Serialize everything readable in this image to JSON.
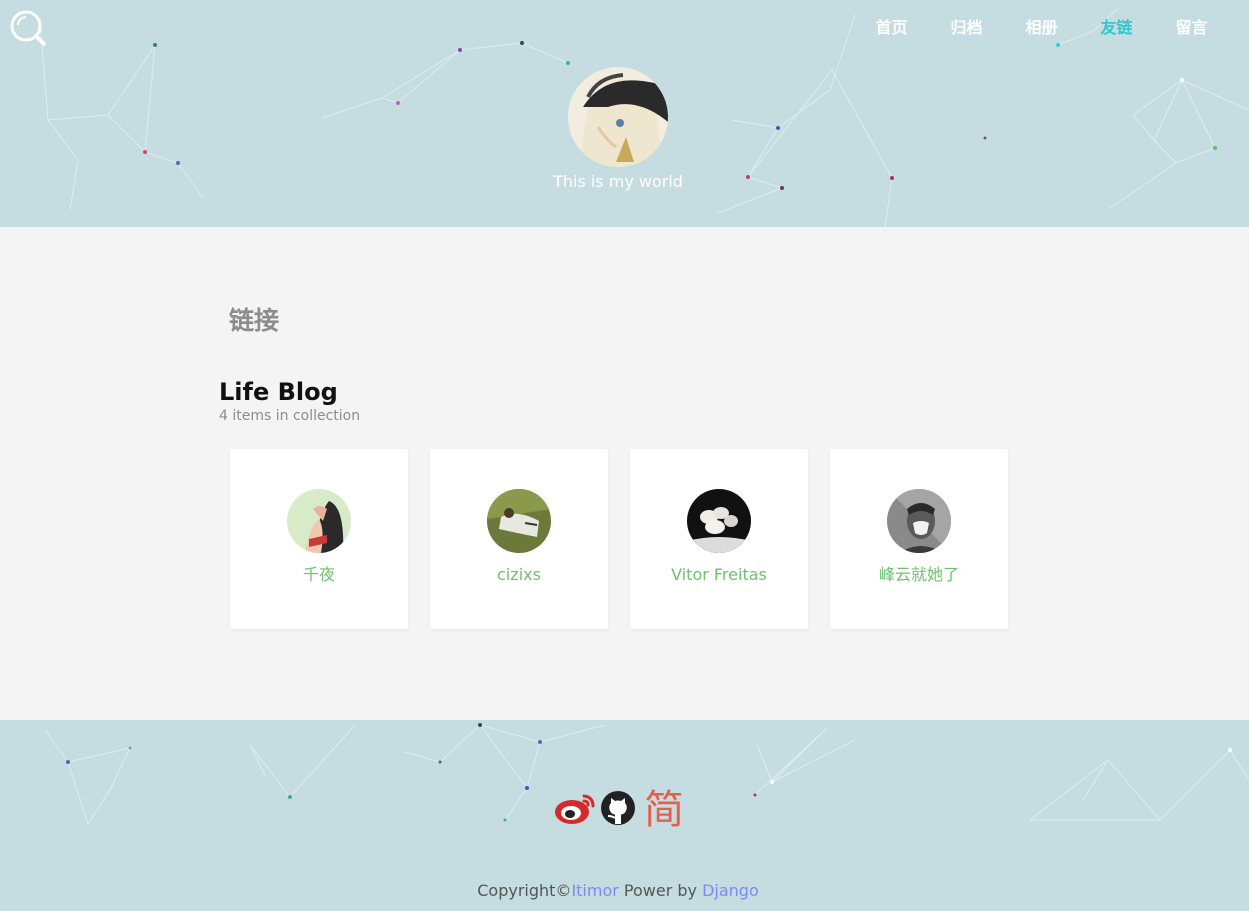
{
  "header": {
    "search_icon": "search-icon",
    "tagline": "This is my world",
    "nav": [
      {
        "label": "首页",
        "active": false
      },
      {
        "label": "归档",
        "active": false
      },
      {
        "label": "相册",
        "active": false
      },
      {
        "label": "友链",
        "active": true
      },
      {
        "label": "留言",
        "active": false
      }
    ]
  },
  "main": {
    "section_title": "链接",
    "collection": {
      "title": "Life Blog",
      "subtitle": "4 items in collection",
      "links": [
        {
          "name": "千夜"
        },
        {
          "name": "cizixs"
        },
        {
          "name": "Vitor Freitas"
        },
        {
          "name": "峰云就她了"
        }
      ]
    }
  },
  "footer": {
    "social": [
      {
        "icon": "weibo-icon"
      },
      {
        "icon": "github-icon"
      },
      {
        "icon": "jianshu-icon",
        "glyph": "简"
      }
    ],
    "copyright_prefix": "Copyright©",
    "author": "Itimor",
    "power_text": " Power by ",
    "framework": "Django"
  },
  "colors": {
    "banner": "#c5dde0",
    "nav_active": "#2ec8d0",
    "link_name": "#6fc16f",
    "footer_link": "#7a8cf0",
    "weibo": "#d42a2a",
    "jianshu": "#e5604b"
  }
}
